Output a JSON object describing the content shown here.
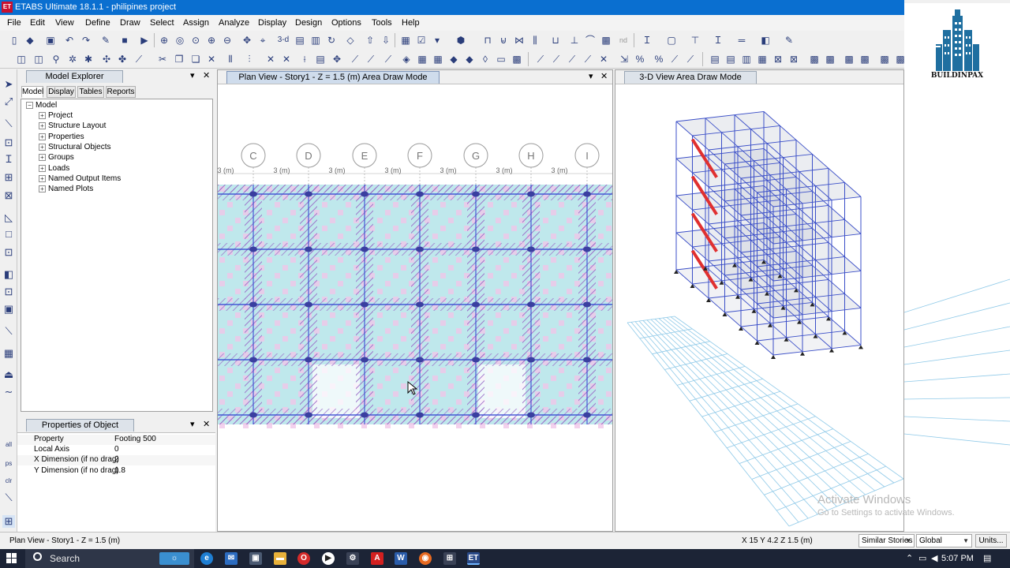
{
  "window": {
    "app_logo": "ET",
    "title": "ETABS Ultimate 18.1.1 - philipines project"
  },
  "menu": [
    "File",
    "Edit",
    "View",
    "Define",
    "Draw",
    "Select",
    "Assign",
    "Analyze",
    "Display",
    "Design",
    "Options",
    "Tools",
    "Help"
  ],
  "toolbar": {
    "view_3d_label": "3-d",
    "nd_label": "nd"
  },
  "brand_logo": {
    "text": "BUILDINPAX",
    "color": "#1f6fa0"
  },
  "model_explorer": {
    "title": "Model Explorer",
    "tabs": [
      "Model",
      "Display",
      "Tables",
      "Reports"
    ],
    "active_tab": "Model",
    "root": "Model",
    "items": [
      "Project",
      "Structure Layout",
      "Properties",
      "Structural Objects",
      "Groups",
      "Loads",
      "Named Output Items",
      "Named Plots"
    ]
  },
  "properties_panel": {
    "title": "Properties of Object",
    "rows": [
      {
        "key": "Property",
        "value": "Footing 500"
      },
      {
        "key": "Local Axis",
        "value": "0"
      },
      {
        "key": "X Dimension (if no drag)",
        "value": "2"
      },
      {
        "key": "Y Dimension (if no drag)",
        "value": "1.8"
      }
    ]
  },
  "left_toolbar": {
    "labels": [
      "all",
      "ps",
      "clr"
    ]
  },
  "plan_view": {
    "title": "Plan View - Story1 - Z = 1.5 (m)  Area Draw Mode",
    "grid_labels": [
      "C",
      "D",
      "E",
      "F",
      "G",
      "H",
      "I"
    ],
    "spacing_labels": [
      "3 (m)",
      "3 (m)",
      "3 (m)",
      "3 (m)",
      "3 (m)",
      "3 (m)",
      "3 (m)",
      "3"
    ],
    "colors": {
      "grid": "#2a3fd0",
      "hatch": "#9a6cc8",
      "cell_pink": "#f0c6e8",
      "cell_cyan": "#bfe8ec"
    }
  },
  "view3d": {
    "title": "3-D View  Area Draw Mode",
    "colors": {
      "frame": "#3b4fc8",
      "slab": "#c8ccd8",
      "grid": "#8ec9e8",
      "brace": "#e03030"
    }
  },
  "watermark": {
    "title": "Activate Windows",
    "subtitle": "Go to Settings to activate Windows."
  },
  "statusbar": {
    "left": "Plan View - Story1 - Z = 1.5 (m)",
    "coords": "X 15  Y 4.2  Z 1.5 (m)",
    "stories": "Similar Stories",
    "coord_system": "Global",
    "units": "Units..."
  },
  "taskbar": {
    "search": "Search",
    "time": "5:07 PM"
  }
}
